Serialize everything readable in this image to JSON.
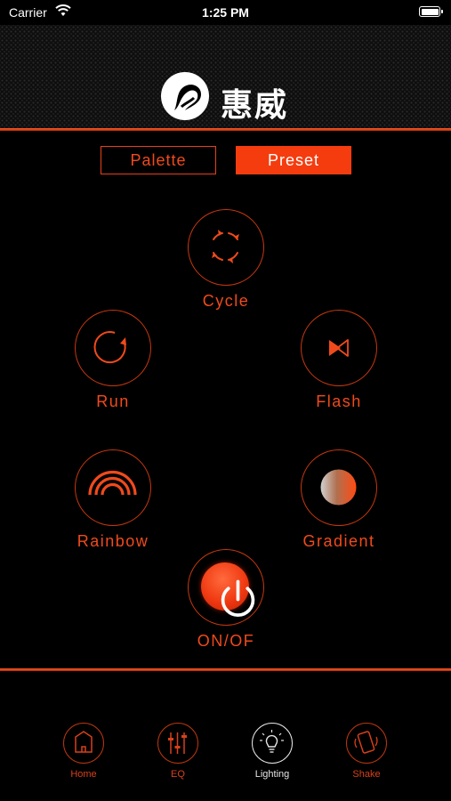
{
  "status_bar": {
    "carrier": "Carrier",
    "time": "1:25 PM"
  },
  "brand": {
    "name": "惠威"
  },
  "segments": [
    {
      "label": "Palette",
      "active": false
    },
    {
      "label": "Preset",
      "active": true
    }
  ],
  "modes": {
    "cycle": "Cycle",
    "run": "Run",
    "flash": "Flash",
    "rainbow": "Rainbow",
    "gradient": "Gradient",
    "power": "ON/OF"
  },
  "tabs": [
    {
      "label": "Home",
      "icon": "home-icon",
      "active": false
    },
    {
      "label": "EQ",
      "icon": "eq-sliders-icon",
      "active": false
    },
    {
      "label": "Lighting",
      "icon": "lightbulb-icon",
      "active": true
    },
    {
      "label": "Shake",
      "icon": "phone-shake-icon",
      "active": false
    }
  ],
  "colors": {
    "accent": "#f04a1c",
    "accent_fill": "#f53c0e",
    "background": "#000000",
    "active_tab": "#e6e6e6"
  }
}
